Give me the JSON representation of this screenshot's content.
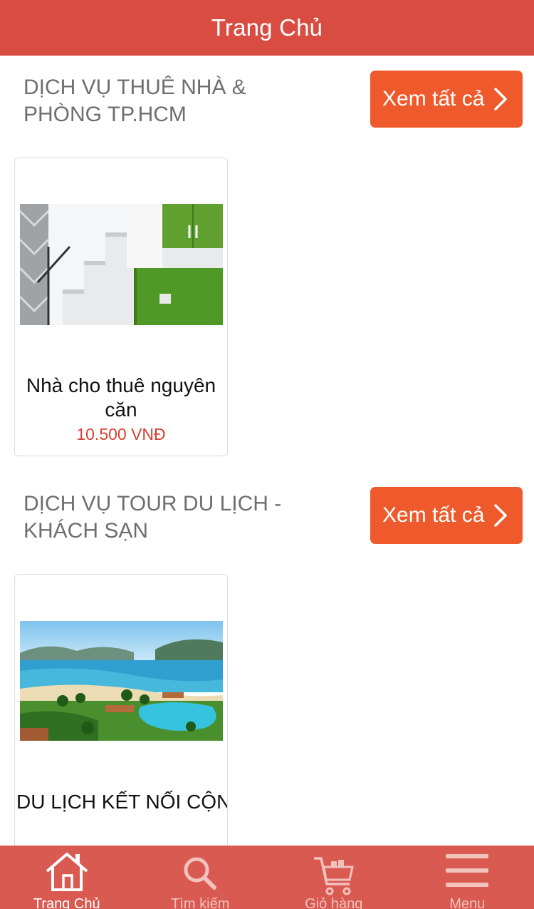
{
  "header": {
    "title": "Trang Chủ"
  },
  "sections": [
    {
      "title": "DỊCH VỤ THUÊ NHÀ & PHÒNG TP.HCM",
      "view_all_label": "Xem tất cả",
      "products": [
        {
          "name": "Nhà cho thuê nguyên căn",
          "price": "10.500 VNĐ"
        }
      ]
    },
    {
      "title": "DỊCH VỤ TOUR DU LỊCH - KHÁCH SẠN",
      "view_all_label": "Xem tất cả",
      "products": [
        {
          "name": "DU LỊCH KẾT NỐI CỘNG ĐỒNG CHU...",
          "price": ""
        }
      ]
    }
  ],
  "tabbar": {
    "items": [
      {
        "label": "Trang Chủ",
        "icon": "home-icon",
        "active": true
      },
      {
        "label": "Tìm kiếm",
        "icon": "search-icon",
        "active": false
      },
      {
        "label": "Giỏ hàng",
        "icon": "cart-icon",
        "active": false
      },
      {
        "label": "Menu",
        "icon": "menu-icon",
        "active": false
      }
    ]
  },
  "colors": {
    "header_bg": "#d94c42",
    "button_bg": "#ee5a2b",
    "price": "#d8402f",
    "tabbar_bg": "#d95a51"
  }
}
